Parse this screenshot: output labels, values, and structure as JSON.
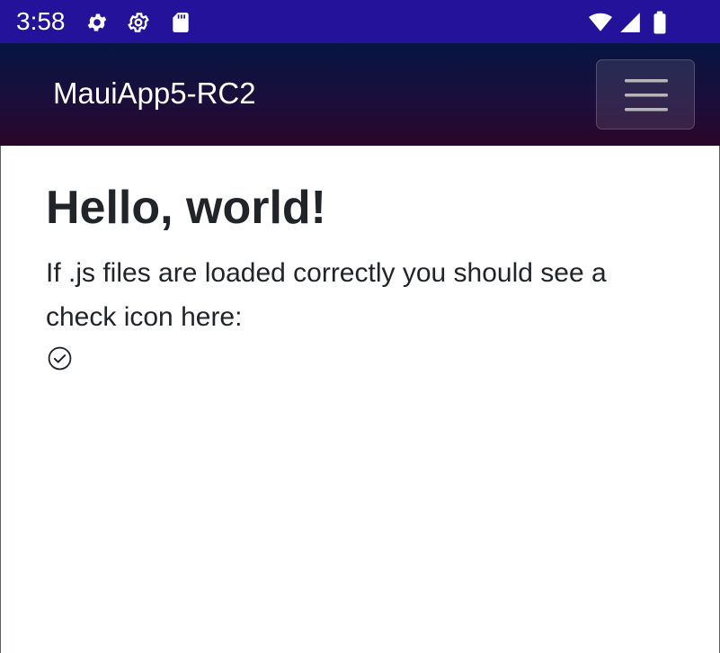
{
  "status_bar": {
    "time": "3:58",
    "icons": [
      "settings-gear-icon",
      "settings-outline-icon",
      "sd-card-icon",
      "wifi-icon",
      "signal-icon",
      "battery-icon"
    ],
    "background": "#24129a"
  },
  "app_bar": {
    "title": "MauiApp5-RC2",
    "menu_icon": "hamburger-menu-icon"
  },
  "main": {
    "heading": "Hello, world!",
    "description": "If .js files are loaded correctly you should see a check icon here:",
    "check_icon": "check-circle-icon"
  },
  "colors": {
    "text": "#212529",
    "status_bar": "#24129a",
    "app_bar_top": "#061541",
    "app_bar_bottom": "#2a0629"
  }
}
